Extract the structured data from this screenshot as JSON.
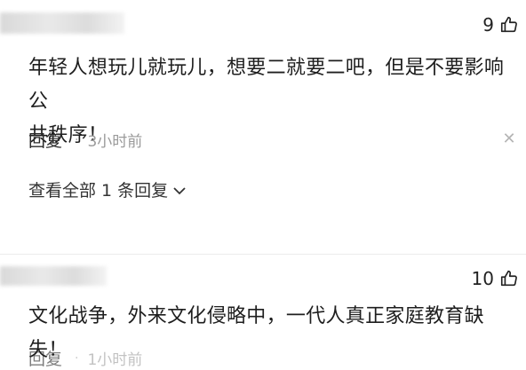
{
  "comments": [
    {
      "likes": "9",
      "text_line1": "年轻人想玩儿就玩儿，想要二就要二吧，但是不要影响公",
      "text_line2": "共秩序！",
      "reply_label": "回复",
      "time": "3小时前",
      "expand_label": "查看全部 1 条回复"
    },
    {
      "likes": "10",
      "text_line1": "文化战争，外来文化侵略中，一代人真正家庭教育缺失！",
      "reply_label": "回复",
      "time": "1小时前"
    }
  ],
  "icons": {
    "like": "thumbs-up-icon",
    "close": "close-icon",
    "chevron": "chevron-down-icon"
  },
  "colors": {
    "text": "#1e1e1e",
    "meta": "#9a9a9a"
  }
}
